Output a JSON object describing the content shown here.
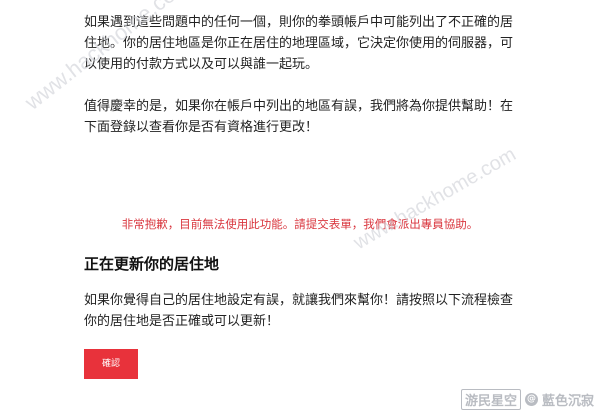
{
  "content": {
    "paragraph1": "如果遇到這些問題中的任何一個，則你的拳頭帳戶中可能列出了不正確的居住地。你的居住地區是你正在居住的地理區域，它決定你使用的伺服器，可以使用的付款方式以及可以與誰一起玩。",
    "paragraph2": "值得慶幸的是，如果你在帳戶中列出的地區有誤，我們將為你提供幫助！在下面登錄以查看你是否有資格進行更改！",
    "error_message": "非常抱歉，目前無法使用此功能。請提交表單，我們會派出專員協助。",
    "section_heading": "正在更新你的居住地",
    "paragraph3": "如果你覺得自己的居住地設定有誤，就讓我們來幫你！請按照以下流程檢查你的居住地是否正確或可以更新！",
    "confirm_button": "確認"
  },
  "watermarks": {
    "left": "www.hackhome.com",
    "right": "www.hackhome.com",
    "logo_boxed": "游民星空",
    "logo_text": "藍色沉寂"
  },
  "colors": {
    "accent": "#e8323b",
    "error_text": "#d9363e",
    "body_text": "#222222"
  }
}
